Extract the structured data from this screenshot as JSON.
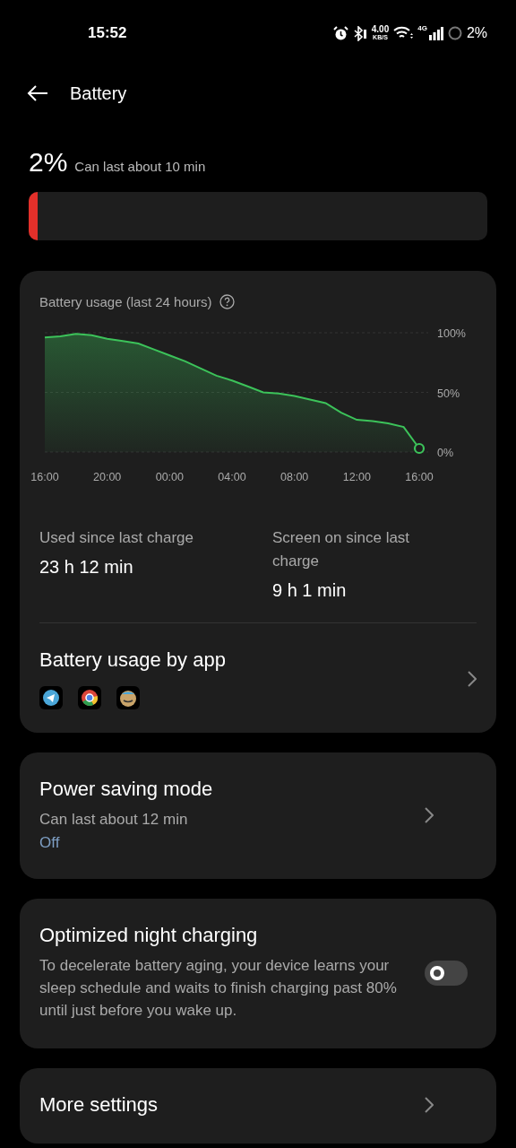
{
  "status_bar": {
    "time": "15:52",
    "net_speed": "4.00",
    "net_speed_unit": "KB/S",
    "network_type": "4G",
    "battery": "2%"
  },
  "header": {
    "title": "Battery"
  },
  "battery": {
    "percent": "2%",
    "estimate": "Can last about 10 min",
    "level": 0.02
  },
  "usage_card": {
    "title": "Battery usage (last 24 hours)",
    "chart_data": {
      "type": "area",
      "categories": [
        "16:00",
        null,
        null,
        null,
        "20:00",
        null,
        null,
        null,
        "00:00",
        null,
        null,
        null,
        "04:00",
        null,
        null,
        null,
        "08:00",
        null,
        null,
        null,
        "12:00",
        null,
        null,
        null,
        "16:00"
      ],
      "series": [
        {
          "color": "#3cc35a",
          "values": [
            96,
            97,
            99,
            98,
            95,
            93,
            91,
            86,
            81,
            76,
            70,
            64,
            60,
            55,
            50,
            49,
            47,
            44,
            41,
            33,
            27,
            26,
            24,
            21,
            3
          ]
        }
      ],
      "yticks": [
        {
          "value": 100,
          "label": "100%"
        },
        {
          "value": 50,
          "label": "50%"
        },
        {
          "value": 0,
          "label": "0%"
        }
      ],
      "ylim": [
        0,
        100
      ]
    },
    "stats": [
      {
        "label": "Used since last charge",
        "value": "23 h 12 min"
      },
      {
        "label": "Screen on since last charge",
        "value": "9 h 1 min"
      }
    ],
    "by_app": {
      "title": "Battery usage by app"
    }
  },
  "power_saving": {
    "title": "Power saving mode",
    "subtitle": "Can last about 12 min",
    "status": "Off"
  },
  "night_charging": {
    "title": "Optimized night charging",
    "description": "To decelerate battery aging, your device learns your sleep schedule and waits to finish charging past 80% until just before you wake up.",
    "on": false
  },
  "more_settings": {
    "title": "More settings"
  }
}
